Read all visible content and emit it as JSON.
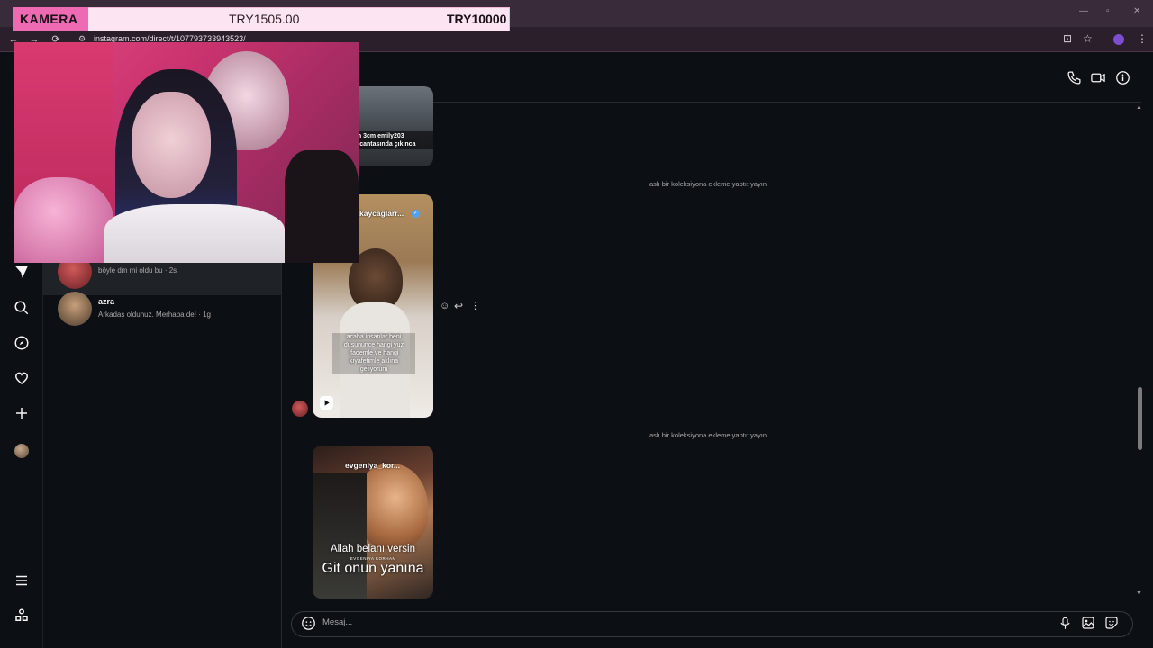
{
  "browser": {
    "url": "instagram.com/direct/t/107793733943523/",
    "back_glyph": "←",
    "forward_glyph": "→",
    "reload_glyph": "⟳",
    "bookmark_glyph": "☆",
    "menu_glyph": "⋮",
    "install_glyph": "⊡"
  },
  "donation": {
    "label": "KAMERA",
    "current": "TRY1505.00",
    "goal": "TRY10000",
    "colors": {
      "label_bg": "#ee6ab2",
      "bar_bg": "#fde4f2"
    }
  },
  "conversations": [
    {
      "name": "",
      "preview": "böyle dm mi oldu bu · 2s",
      "active": true
    },
    {
      "name": "azra",
      "preview": "Arkadaş oldunuz. Merhaba de! · 1g",
      "active": false
    }
  ],
  "chat": {
    "system_messages": [
      "aslı bir koleksiyona ekleme yaptı: yayın",
      "aslı bir koleksiyona ekleme yaptı: yayın"
    ],
    "posts": [
      {
        "user": "",
        "caption": "an 3cm emily203\nn cantasında çıkınca"
      },
      {
        "user": "kaycaglarr...",
        "verified": true,
        "caption": "acaba insanlar beni\ndusununce hangi yuz\nifademle ve hangi\nkıyafetimle aklına\ngeliyorum"
      },
      {
        "user": "evgeniya_kor...",
        "caption_line1": "Allah belanı versin",
        "caption_small": "EVGENIYA KORHAN",
        "caption_line2": "Git onun yanına"
      }
    ]
  },
  "composer": {
    "placeholder": "Mesaj..."
  },
  "colors": {
    "background": "#0c1014",
    "text_secondary": "#a8a8a8"
  }
}
